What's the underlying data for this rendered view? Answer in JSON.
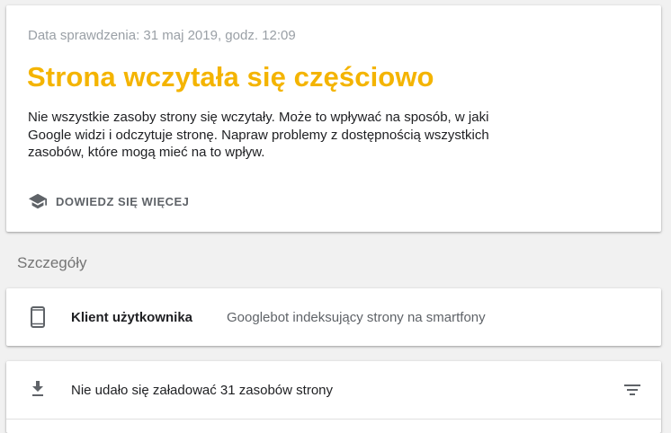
{
  "status_card": {
    "check_date": "Data sprawdzenia: 31 maj 2019, godz. 12:09",
    "title": "Strona wczytała się częściowo",
    "description": "Nie wszystkie zasoby strony się wczytały. Może to wpływać na sposób, w jaki Google widzi i odczytuje stronę. Napraw problemy z dostępnością wszystkich zasobów, które mogą mieć na to wpływ.",
    "learn_more": {
      "icon": "school-icon",
      "label": "DOWIEDZ SIĘ WIĘCEJ"
    },
    "title_color": "#f4b400"
  },
  "details": {
    "heading": "Szczegóły",
    "user_agent": {
      "icon": "smartphone-icon",
      "label": "Klient użytkownika",
      "value": "Googlebot indeksujący strony na smartfony"
    },
    "resources": {
      "icon": "download-icon",
      "label": "Nie udało się załadować 31 zasobów strony",
      "action_icon": "filter-icon"
    }
  }
}
